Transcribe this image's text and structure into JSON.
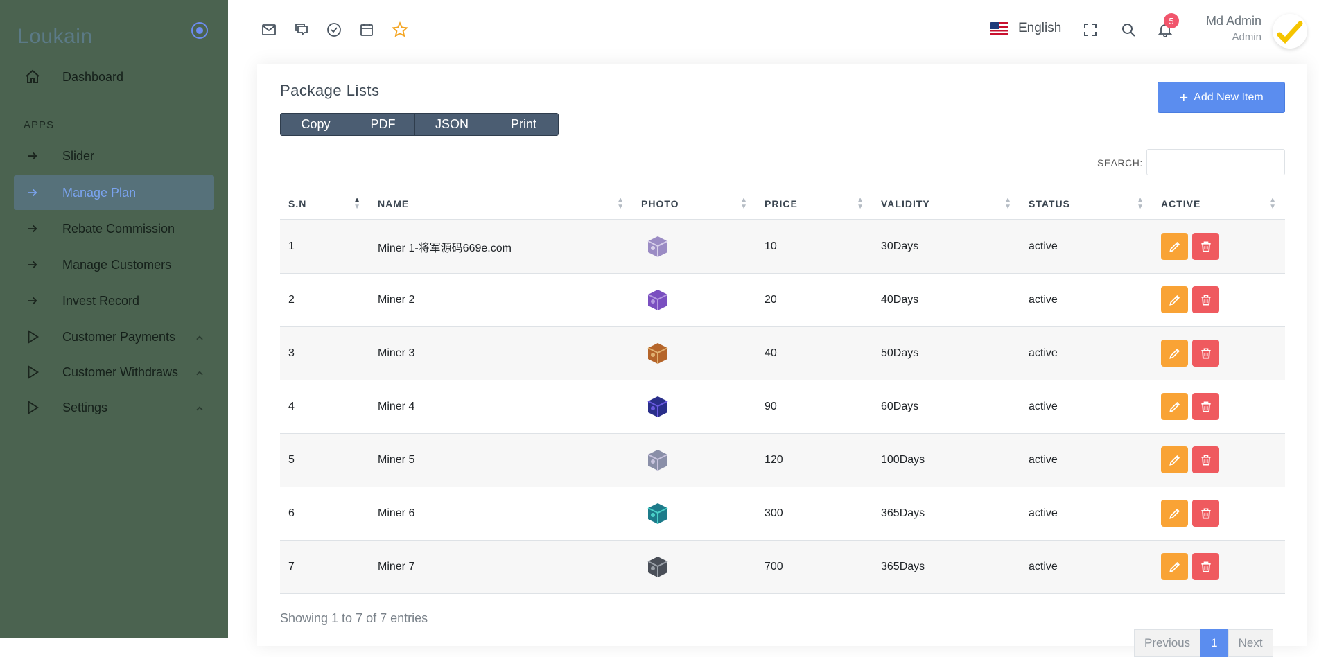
{
  "sidebar": {
    "brand": "Loukain",
    "section_label": "APPS",
    "items": [
      {
        "label": "Dashboard"
      },
      {
        "label": "Slider"
      },
      {
        "label": "Manage Plan"
      },
      {
        "label": "Rebate Commission"
      },
      {
        "label": "Manage Customers"
      },
      {
        "label": "Invest Record"
      },
      {
        "label": "Customer Payments"
      },
      {
        "label": "Customer Withdraws"
      },
      {
        "label": "Settings"
      }
    ]
  },
  "header": {
    "language": "English",
    "notification_count": "5",
    "user_name": "Md Admin",
    "user_role": "Admin",
    "icons": [
      "mail-icon",
      "chat-icon",
      "check-circle-icon",
      "calendar-icon",
      "star-icon",
      "fullscreen-icon",
      "search-icon",
      "bell-icon"
    ],
    "accent_star": "#f4a523"
  },
  "card": {
    "title": "Package Lists",
    "add_button": "Add New Item",
    "export_buttons": [
      "Copy",
      "PDF",
      "JSON",
      "Print"
    ],
    "search_label": "SEARCH:",
    "search_value": "",
    "columns": [
      "S.N",
      "NAME",
      "PHOTO",
      "PRICE",
      "VALIDITY",
      "STATUS",
      "ACTIVE"
    ],
    "rows": [
      {
        "sn": "1",
        "name": "Miner 1-将军源码669e.com",
        "price": "10",
        "validity": "30Days",
        "status": "active"
      },
      {
        "sn": "2",
        "name": "Miner 2",
        "price": "20",
        "validity": "40Days",
        "status": "active"
      },
      {
        "sn": "3",
        "name": "Miner 3",
        "price": "40",
        "validity": "50Days",
        "status": "active"
      },
      {
        "sn": "4",
        "name": "Miner 4",
        "price": "90",
        "validity": "60Days",
        "status": "active"
      },
      {
        "sn": "5",
        "name": "Miner 5",
        "price": "120",
        "validity": "100Days",
        "status": "active"
      },
      {
        "sn": "6",
        "name": "Miner 6",
        "price": "300",
        "validity": "365Days",
        "status": "active"
      },
      {
        "sn": "7",
        "name": "Miner 7",
        "price": "700",
        "validity": "365Days",
        "status": "active"
      }
    ],
    "info": "Showing 1 to 7 of 7 entries",
    "pager": {
      "previous": "Previous",
      "current": "1",
      "next": "Next"
    }
  },
  "colors": {
    "sidebar_bg": "#4b6350",
    "active_item_bg": "#56717a",
    "primary": "#5b8def",
    "edit": "#f9a335",
    "delete": "#ef5a5f"
  }
}
